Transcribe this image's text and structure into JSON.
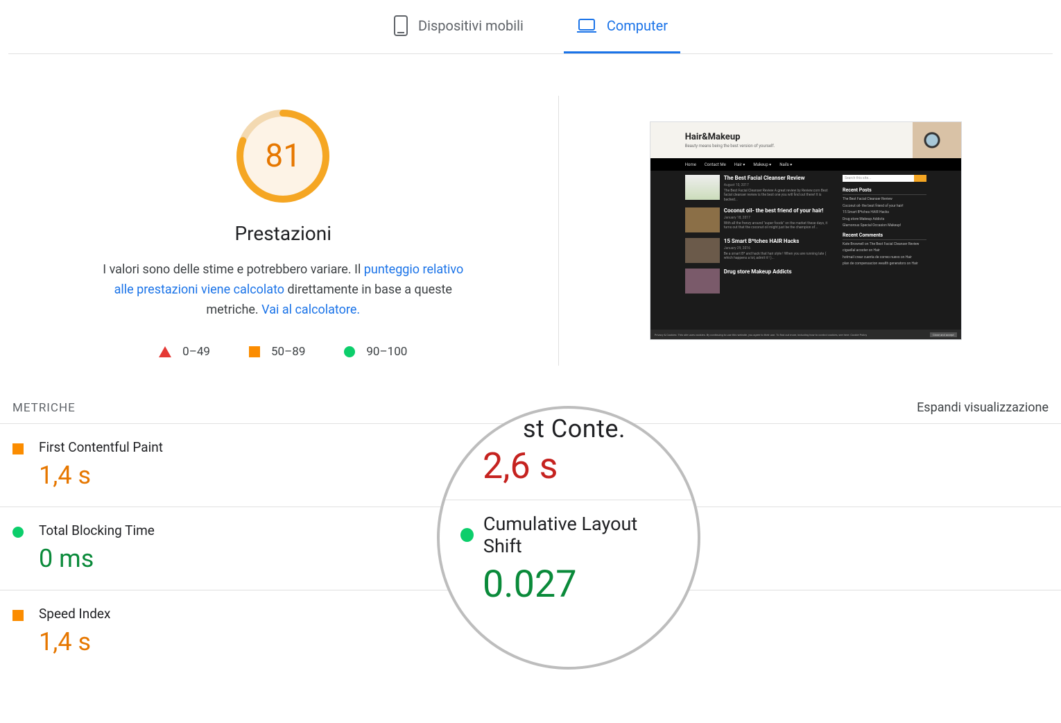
{
  "tabs": {
    "mobile": "Dispositivi mobili",
    "desktop": "Computer"
  },
  "gauge": {
    "score": "81",
    "title": "Prestazioni",
    "desc_prefix": "I valori sono delle stime e potrebbero variare. Il ",
    "desc_link1": "punteggio relativo alle prestazioni viene calcolato",
    "desc_mid": " direttamente in base a queste metriche. ",
    "desc_link2": "Vai al calcolatore."
  },
  "legend": {
    "bad": "0–49",
    "mid": "50–89",
    "good": "90–100"
  },
  "screenshot": {
    "title": "Hair&Makeup",
    "subtitle": "Beauty means being the best version of yourself.",
    "nav": [
      "Home",
      "Contact Me",
      "Hair ▾",
      "Makeup ▾",
      "Nails ▾"
    ],
    "posts": [
      {
        "title": "The Best Facial Cleanser Review",
        "date": "August 10, 2017",
        "text": "The Best Facial Cleanser Review A great review by Review.com Best facial cleanser review is the best one you will find out there! It is backed..."
      },
      {
        "title": "Coconut oil- the best friend of your hair!",
        "date": "January 18, 2017",
        "text": "With all the frenzy around \"super foods\" on the market these days, it turns out that the coconut oil might just be the champion of..."
      },
      {
        "title": "15 Smart B*tches HAIR Hacks",
        "date": "January 29, 2016",
        "text": "Be a smart B* and hack that hair style ! When you are running late ( which happens a lot, admit it ! )..."
      },
      {
        "title": "Drug store Makeup Addicts",
        "date": "",
        "text": ""
      }
    ],
    "search_placeholder": "Search this site...",
    "recent_posts_h": "Recent Posts",
    "recent_posts": [
      "The Best Facial Cleanser Review",
      "Coconut oil- the best friend of your hair!",
      "15 Smart B*tches HAIR Hacks",
      "Drug store Makeup Addicts",
      "Glamorous Special Occasion Makeup!"
    ],
    "recent_comments_h": "Recent Comments",
    "recent_comments": [
      "Kate Brownell on The Best Facial Cleanser Review",
      "ciguellal acoster on Hair",
      "hotmail crear cuenta de correo nuevo on Hair",
      "plan de compensacion wealth generators on Hair"
    ],
    "cookie_text": "Privacy & Cookies: This site uses cookies. By continuing to use this website, you agree to their use. To find out more, including how to control cookies, see here: Cookie Policy",
    "cookie_btn": "Close and accept"
  },
  "metrics_header": {
    "label": "METRICHE",
    "expand": "Espandi visualizzazione"
  },
  "metrics": {
    "fcp": {
      "name": "First Contentful Paint",
      "value": "1,4 s"
    },
    "tbt": {
      "name": "Total Blocking Time",
      "value": "0 ms"
    },
    "si": {
      "name": "Speed Index",
      "value": "1,4 s"
    }
  },
  "lens": {
    "partial_top": "st Conte.",
    "value_top": "2,6 s",
    "cls_label": "Cumulative Layout Shift",
    "cls_value": "0.027"
  }
}
